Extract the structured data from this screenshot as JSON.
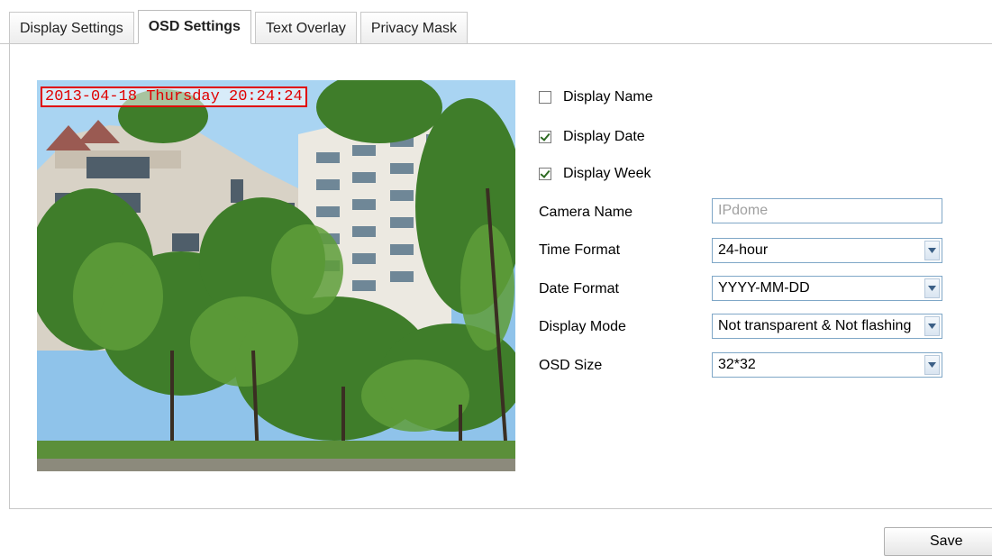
{
  "tabs": [
    {
      "label": "Display Settings",
      "active": false
    },
    {
      "label": "OSD Settings",
      "active": true
    },
    {
      "label": "Text Overlay",
      "active": false
    },
    {
      "label": "Privacy Mask",
      "active": false
    }
  ],
  "preview": {
    "osd_stamp": "2013-04-18 Thursday 20:24:24"
  },
  "options": {
    "display_name": {
      "label": "Display Name",
      "checked": false
    },
    "display_date": {
      "label": "Display Date",
      "checked": true
    },
    "display_week": {
      "label": "Display Week",
      "checked": true
    }
  },
  "fields": {
    "camera_name": {
      "label": "Camera Name",
      "value": "IPdome"
    },
    "time_format": {
      "label": "Time Format",
      "value": "24-hour"
    },
    "date_format": {
      "label": "Date Format",
      "value": "YYYY-MM-DD"
    },
    "display_mode": {
      "label": "Display Mode",
      "value": "Not transparent & Not flashing"
    },
    "osd_size": {
      "label": "OSD Size",
      "value": "32*32"
    }
  },
  "save_label": "Save",
  "colors": {
    "osd_stamp": "#e00000",
    "input_border": "#7fa7c7"
  }
}
